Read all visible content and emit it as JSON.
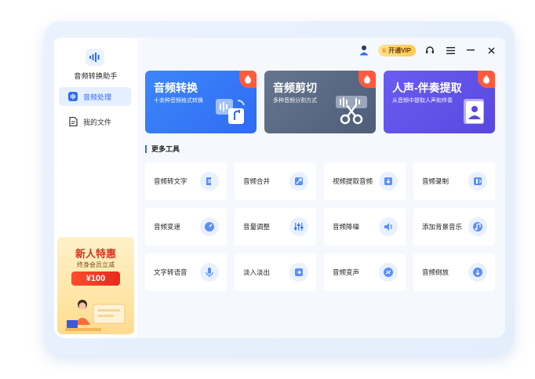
{
  "app": {
    "name": "音频转换助手"
  },
  "sidebar": {
    "items": [
      {
        "label": "音频处理",
        "icon": "audio-wave-icon",
        "active": true
      },
      {
        "label": "我的文件",
        "icon": "file-icon",
        "active": false
      }
    ]
  },
  "promo": {
    "title": "新人特惠",
    "subtitle": "终身会员立减",
    "price": "¥100"
  },
  "topbar": {
    "vip_label": "开通VIP",
    "icons": [
      "user-icon",
      "crown-icon",
      "support-icon",
      "menu-icon",
      "minimize-icon",
      "close-icon"
    ]
  },
  "cards": [
    {
      "title": "音频转换",
      "desc": "十余种音频格式转换",
      "color": "#3b7bf6",
      "icon": "audio-convert-icon"
    },
    {
      "title": "音频剪切",
      "desc": "多种音频分割方式",
      "color": "#5a6a86",
      "icon": "audio-cut-icon"
    },
    {
      "title": "人声-伴奏提取",
      "desc": "从音频中提取人声和伴奏",
      "color": "#6254e8",
      "icon": "vocal-extract-icon"
    }
  ],
  "more_tools": {
    "title": "更多工具",
    "items": [
      {
        "label": "音频转文字",
        "icon": "audio-to-text-icon"
      },
      {
        "label": "音频合并",
        "icon": "merge-icon"
      },
      {
        "label": "视频提取音频",
        "icon": "video-extract-icon"
      },
      {
        "label": "音频录制",
        "icon": "record-icon"
      },
      {
        "label": "音频变速",
        "icon": "speed-icon"
      },
      {
        "label": "音量调整",
        "icon": "volume-adjust-icon"
      },
      {
        "label": "音频降噪",
        "icon": "denoise-icon"
      },
      {
        "label": "添加背景音乐",
        "icon": "bgm-icon"
      },
      {
        "label": "文字转语音",
        "icon": "text-to-speech-icon"
      },
      {
        "label": "淡入淡出",
        "icon": "fade-icon"
      },
      {
        "label": "音频变声",
        "icon": "voice-change-icon"
      },
      {
        "label": "音频倒放",
        "icon": "reverse-icon"
      }
    ]
  }
}
